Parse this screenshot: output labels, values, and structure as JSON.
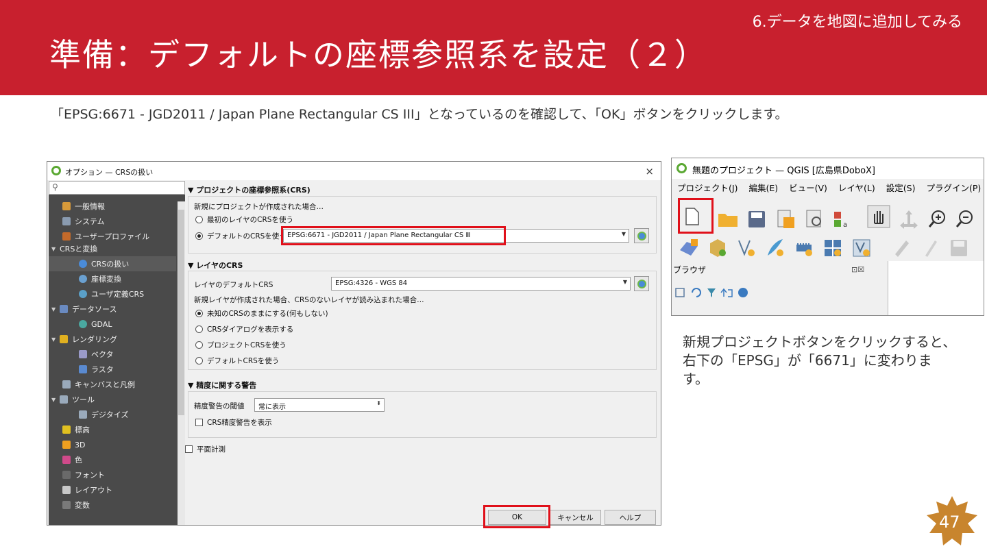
{
  "header": {
    "section": "6.データを地図に追加してみる",
    "title": "準備：デフォルトの座標参照系を設定（２）"
  },
  "description": "「EPSG:6671 - JGD2011 / Japan Plane Rectangular CS III」となっているのを確認して、「OK」ボタンをクリックします。",
  "dialog": {
    "title": "オプション — CRSの扱い",
    "close_glyph": "×",
    "search_icon": "magnifier-icon",
    "nav_items": [
      {
        "label": "一般情報",
        "icon": "tools-icon"
      },
      {
        "label": "システム",
        "icon": "gear-icon"
      },
      {
        "label": "ユーザープロファイル",
        "icon": "user-icon"
      },
      {
        "label": "CRSと変換",
        "icon": "expand-icon"
      },
      {
        "label": "CRSの扱い",
        "icon": "globe-icon"
      },
      {
        "label": "座標変換",
        "icon": "transform-icon"
      },
      {
        "label": "ユーザ定義CRS",
        "icon": "custom-crs-icon"
      },
      {
        "label": "データソース",
        "icon": "table-icon"
      },
      {
        "label": "GDAL",
        "icon": "gdal-icon"
      },
      {
        "label": "レンダリング",
        "icon": "brush-icon"
      },
      {
        "label": "ベクタ",
        "icon": "vector-icon"
      },
      {
        "label": "ラスタ",
        "icon": "raster-icon"
      },
      {
        "label": "キャンバスと凡例",
        "icon": "canvas-icon"
      },
      {
        "label": "ツール",
        "icon": "toolbox-icon"
      },
      {
        "label": "デジタイズ",
        "icon": "digitize-icon"
      },
      {
        "label": "標高",
        "icon": "elevation-icon"
      },
      {
        "label": "3D",
        "icon": "cube-icon"
      },
      {
        "label": "色",
        "icon": "color-icon"
      },
      {
        "label": "フォント",
        "icon": "font-icon"
      },
      {
        "label": "レイアウト",
        "icon": "layout-icon"
      },
      {
        "label": "変数",
        "icon": "variables-icon"
      }
    ],
    "project_crs": {
      "heading": "プロジェクトの座標参照系(CRS)",
      "intro": "新規にプロジェクトが作成された場合…",
      "option_first": "最初のレイヤのCRSを使う",
      "option_default": "デフォルトのCRSを使う",
      "default_crs_value": "EPSG:6671 - JGD2011 / Japan Plane Rectangular CS Ⅲ"
    },
    "layer_crs": {
      "heading": "レイヤのCRS",
      "default_label": "レイヤのデフォルトCRS",
      "default_value": "EPSG:4326 - WGS 84",
      "intro": "新規レイヤが作成された場合、CRSのないレイヤが読み込まれた場合…",
      "options": [
        "未知のCRSのままにする(何もしない)",
        "CRSダイアログを表示する",
        "プロジェクトCRSを使う",
        "デフォルトCRSを使う"
      ]
    },
    "accuracy": {
      "heading": "精度に関する警告",
      "threshold_label": "精度警告の閾値",
      "threshold_value": "常に表示",
      "show_warning": "CRS精度警告を表示"
    },
    "planimetric": "平面計測",
    "buttons": {
      "ok": "OK",
      "cancel": "キャンセル",
      "help": "ヘルプ"
    }
  },
  "qgis": {
    "title": "無題のプロジェクト — QGIS [広島県DoboX]",
    "menu": [
      "プロジェクト(J)",
      "編集(E)",
      "ビュー(V)",
      "レイヤ(L)",
      "設定(S)",
      "プラグイン(P)"
    ],
    "browser_title": "ブラウザ",
    "browser_controls": "⊡☒"
  },
  "note": "新規プロジェクトボタンをクリックすると、右下の「EPSG」が「6671」に変わります。",
  "page_number": "47"
}
